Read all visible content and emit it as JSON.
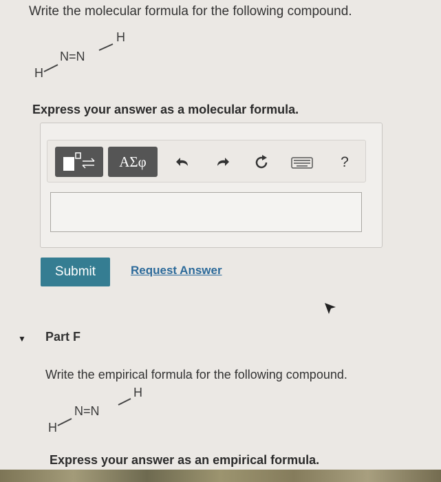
{
  "question": {
    "title": "Write the molecular formula for the following compound.",
    "molecule": {
      "left_h": "H",
      "center": "N=N",
      "right_h": "H"
    },
    "prompt": "Express your answer as a molecular formula."
  },
  "toolbar": {
    "symbols_label": "ΑΣφ",
    "help_label": "?",
    "icons": [
      "templates-icon",
      "undo-icon",
      "redo-icon",
      "reset-icon",
      "keyboard-icon",
      "help-icon"
    ]
  },
  "answer": {
    "value": ""
  },
  "actions": {
    "submit_label": "Submit",
    "request_label": "Request Answer"
  },
  "part_f": {
    "label": "Part F",
    "title": "Write the empirical formula for the following compound.",
    "molecule": {
      "left_h": "H",
      "center": "N=N",
      "right_h": "H"
    },
    "prompt": "Express your answer as an empirical formula."
  },
  "colors": {
    "submit_bg": "#357d92",
    "link": "#2c6a9a",
    "toolbar_btn": "#555555"
  }
}
